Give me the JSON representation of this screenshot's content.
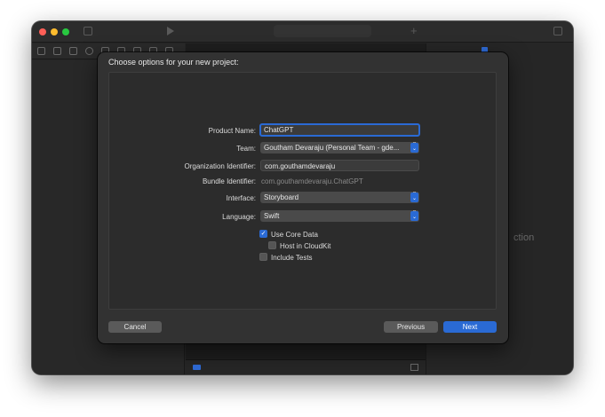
{
  "sheet": {
    "title": "Choose options for your new project:"
  },
  "form": {
    "product_name": {
      "label": "Product Name:",
      "value": "ChatGPT"
    },
    "team": {
      "label": "Team:",
      "value": "Goutham Devaraju (Personal Team - gde..."
    },
    "organization_identifier": {
      "label": "Organization Identifier:",
      "value": "com.gouthamdevaraju"
    },
    "bundle_identifier": {
      "label": "Bundle Identifier:",
      "value": "com.gouthamdevaraju.ChatGPT"
    },
    "interface": {
      "label": "Interface:",
      "value": "Storyboard"
    },
    "language": {
      "label": "Language:",
      "value": "Swift"
    },
    "use_core_data": {
      "label": "Use Core Data",
      "checked": true
    },
    "host_in_cloudkit": {
      "label": "Host in CloudKit",
      "checked": false
    },
    "include_tests": {
      "label": "Include Tests",
      "checked": false
    }
  },
  "buttons": {
    "cancel": "Cancel",
    "previous": "Previous",
    "next": "Next"
  },
  "background": {
    "inspector_placeholder": "ction"
  },
  "colors": {
    "accent": "#2a6ad4",
    "window_bg": "#262626",
    "sheet_bg": "#323232"
  }
}
